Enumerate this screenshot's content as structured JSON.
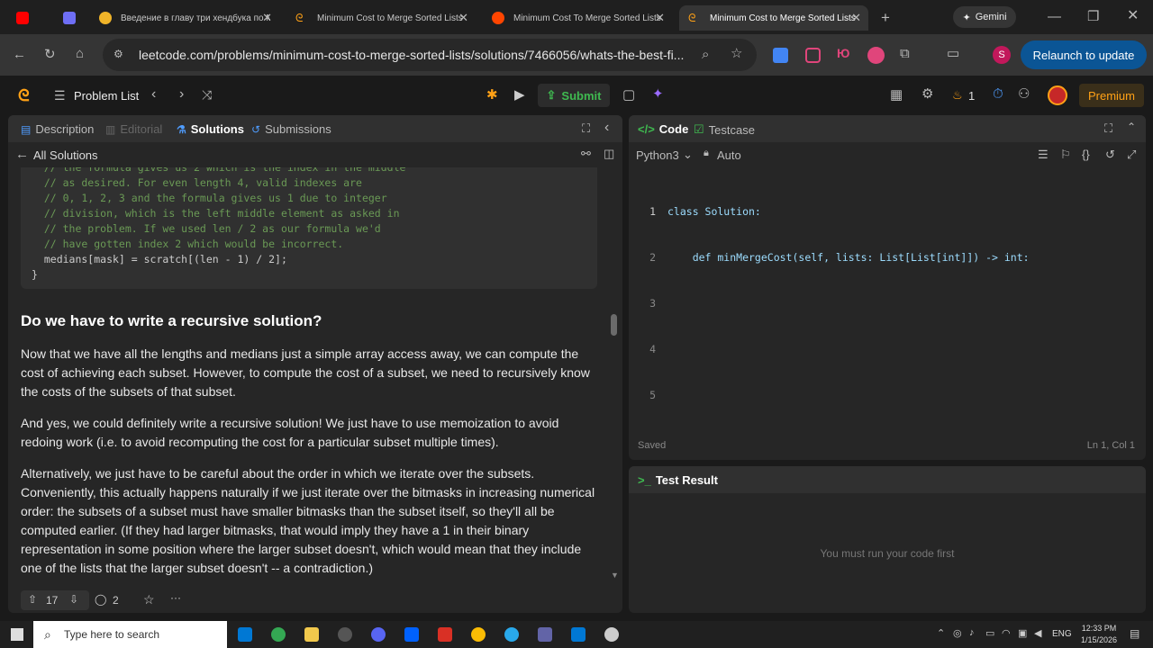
{
  "browser": {
    "tabs": [
      {
        "title": "",
        "active": false
      },
      {
        "title": "",
        "active": false
      },
      {
        "title": "Введение в главу три хендбука по М",
        "active": false
      },
      {
        "title": "Minimum Cost to Merge Sorted Lists",
        "active": false
      },
      {
        "title": "Minimum Cost To Merge Sorted Lists",
        "active": false
      },
      {
        "title": "Minimum Cost to Merge Sorted Lists",
        "active": true
      }
    ],
    "gemini_label": "Gemini",
    "url": "leetcode.com/problems/minimum-cost-to-merge-sorted-lists/solutions/7466056/whats-the-best-fi...",
    "relaunch_label": "Relaunch to update",
    "profile_initial": "S"
  },
  "leetcode": {
    "problem_list_label": "Problem List",
    "submit_label": "Submit",
    "streak_count": "1",
    "premium_label": "Premium"
  },
  "left_panel": {
    "tabs": [
      "Description",
      "Editorial",
      "Solutions",
      "Submissions"
    ],
    "all_solutions_label": "All Solutions",
    "code_lines": [
      "  // the formula gives us 2 which is the index in the middle",
      "  // as desired. For even length 4, valid indexes are",
      "  // 0, 1, 2, 3 and the formula gives us 1 due to integer",
      "  // division, which is the left middle element as asked in",
      "  // the problem. If we used len / 2 as our formula we'd",
      "  // have gotten index 2 which would be incorrect.",
      "  medians[mask] = scratch[(len - 1) / 2];",
      "}"
    ],
    "heading": "Do we have to write a recursive solution?",
    "paragraphs": [
      "Now that we have all the lengths and medians just a simple array access away, we can compute the cost of achieving each subset. However, to compute the cost of a subset, we need to recursively know the costs of the subsets of that subset.",
      "And yes, we could definitely write a recursive solution! We just have to use memoization to avoid redoing work (i.e. to avoid recomputing the cost for a particular subset multiple times).",
      "Alternatively, we just have to be careful about the order in which we iterate over the subsets. Conveniently, this actually happens naturally if we just iterate over the bitmasks in increasing numerical order: the subsets of a subset must have smaller bitmasks than the subset itself, so they'll all be computed earlier. (If they had larger bitmasks, that would imply they have a 1 in their binary representation in some position where the larger subset doesn't, which would mean that they include one of the lists that the larger subset doesn't -- a contradiction.)"
    ],
    "upvotes": "17",
    "comments": "2"
  },
  "code_panel": {
    "tab_code": "Code",
    "tab_testcase": "Testcase",
    "language": "Python3",
    "mode": "Auto",
    "line_numbers": [
      "1",
      "2",
      "3",
      "4",
      "5"
    ],
    "lines": [
      "class Solution:",
      "    def minMergeCost(self, lists: List[List[int]]) -> int:",
      "",
      "",
      ""
    ],
    "saved_label": "Saved",
    "cursor_pos": "Ln 1, Col 1"
  },
  "result_panel": {
    "title": "Test Result",
    "empty_message": "You must run your code first"
  },
  "taskbar": {
    "search_placeholder": "Type here to search",
    "lang": "ENG",
    "time": "12:33 PM",
    "date": "1/15/2026"
  },
  "colors": {
    "accent_orange": "#ffa116",
    "submit_green": "#3fb950",
    "relaunch_blue": "#0b5595"
  }
}
